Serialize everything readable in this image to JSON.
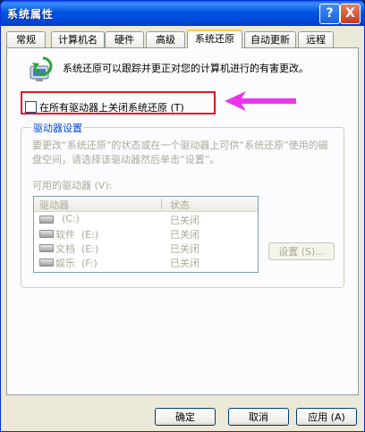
{
  "window": {
    "title": "系统属性",
    "help_glyph": "?",
    "close_glyph": "X"
  },
  "tabs": [
    {
      "label": "常规"
    },
    {
      "label": "计算机名"
    },
    {
      "label": "硬件"
    },
    {
      "label": "高级"
    },
    {
      "label": "系统还原",
      "active": true
    },
    {
      "label": "自动更新"
    },
    {
      "label": "远程"
    }
  ],
  "panel": {
    "description": "系统还原可以跟踪并更正对您的计算机进行的有害更改。",
    "checkbox_label": "在所有驱动器上关闭系统还原 (T)",
    "checkbox_checked": false
  },
  "group": {
    "legend": "驱动器设置",
    "description": "要更改“系统还原”的状态或在一个驱动器上可供“系统还原”使用的磁盘空间，请选择该驱动器然后单击“设置”。",
    "available_label": "可用的驱动器 (V):",
    "columns": [
      "驱动器",
      "状态"
    ],
    "drives": [
      {
        "name": "  (C:)",
        "status": "已关闭"
      },
      {
        "name": "软件  (E:)",
        "status": "已关闭"
      },
      {
        "name": "文档  (E:)",
        "status": "已关闭"
      },
      {
        "name": "娱乐  (F:)",
        "status": "已关闭"
      }
    ],
    "settings_button": "设置 (S)..."
  },
  "footer": {
    "ok": "确定",
    "cancel": "取消",
    "apply": "应用 (A)"
  },
  "colors": {
    "annotation_box": "#e8141e",
    "annotation_arrow": "#ee33ee",
    "legend": "#0046d5"
  }
}
